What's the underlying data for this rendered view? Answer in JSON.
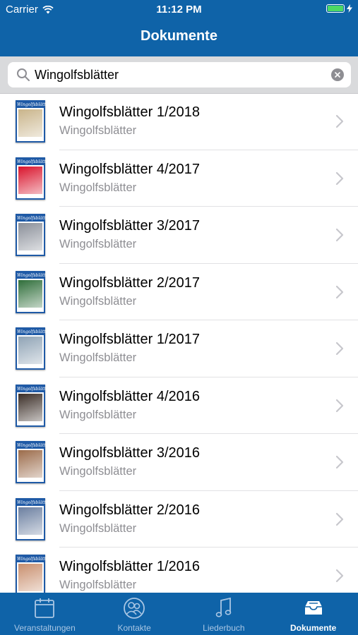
{
  "status_bar": {
    "carrier": "Carrier",
    "time": "11:12 PM"
  },
  "nav": {
    "title": "Dokumente"
  },
  "search": {
    "value": "Wingolfsblätter",
    "placeholder": ""
  },
  "documents": [
    {
      "title": "Wingolfsblätter 1/2018",
      "subtitle": "Wingolfsblätter",
      "cover_color": "#c9b48a"
    },
    {
      "title": "Wingolfsblätter 4/2017",
      "subtitle": "Wingolfsblätter",
      "cover_color": "#d9132b"
    },
    {
      "title": "Wingolfsblätter 3/2017",
      "subtitle": "Wingolfsblätter",
      "cover_color": "#8a8f99"
    },
    {
      "title": "Wingolfsblätter 2/2017",
      "subtitle": "Wingolfsblätter",
      "cover_color": "#2f6e3a"
    },
    {
      "title": "Wingolfsblätter 1/2017",
      "subtitle": "Wingolfsblätter",
      "cover_color": "#8fa3b5"
    },
    {
      "title": "Wingolfsblätter 4/2016",
      "subtitle": "Wingolfsblätter",
      "cover_color": "#3a2d26"
    },
    {
      "title": "Wingolfsblätter 3/2016",
      "subtitle": "Wingolfsblätter",
      "cover_color": "#9b6b4a"
    },
    {
      "title": "Wingolfsblätter 2/2016",
      "subtitle": "Wingolfsblätter",
      "cover_color": "#6b7fa0"
    },
    {
      "title": "Wingolfsblätter 1/2016",
      "subtitle": "Wingolfsblätter",
      "cover_color": "#c98f6e"
    }
  ],
  "tabs": [
    {
      "label": "Veranstaltungen",
      "icon": "calendar-icon"
    },
    {
      "label": "Kontakte",
      "icon": "contacts-icon"
    },
    {
      "label": "Liederbuch",
      "icon": "music-note-icon"
    },
    {
      "label": "Dokumente",
      "icon": "inbox-tray-icon",
      "active": true
    }
  ],
  "colors": {
    "bar": "#0f63a8",
    "tab_inactive": "#a9c6e4",
    "tab_active": "#ffffff",
    "battery": "#4cd964"
  }
}
